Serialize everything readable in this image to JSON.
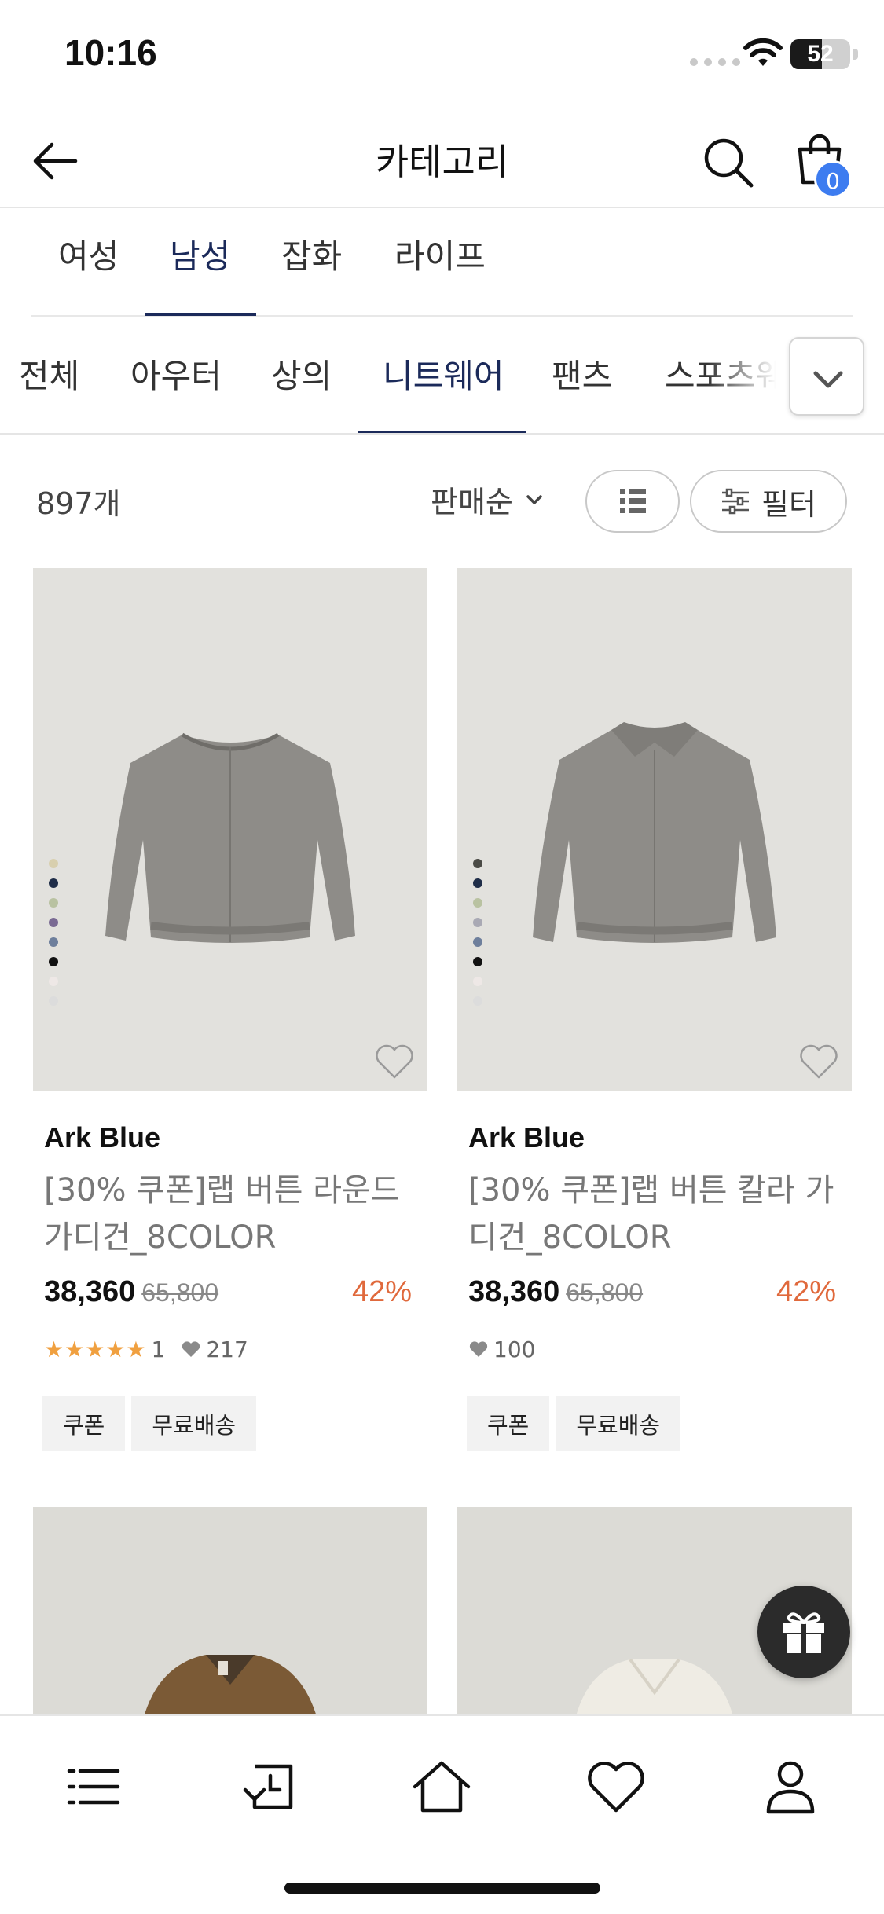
{
  "status_bar": {
    "time": "10:16",
    "battery": "52",
    "battery_level": 0.52
  },
  "header": {
    "title": "카테고리",
    "cart_count": "0"
  },
  "primary_tabs": [
    {
      "label": "여성",
      "active": false
    },
    {
      "label": "남성",
      "active": true
    },
    {
      "label": "잡화",
      "active": false
    },
    {
      "label": "라이프",
      "active": false
    }
  ],
  "secondary_tabs": [
    {
      "label": "전체",
      "active": false
    },
    {
      "label": "아우터",
      "active": false
    },
    {
      "label": "상의",
      "active": false
    },
    {
      "label": "니트웨어",
      "active": true
    },
    {
      "label": "팬츠",
      "active": false
    },
    {
      "label": "스포츠웨",
      "active": false
    }
  ],
  "toolbar": {
    "count": "897개",
    "sort": "판매순",
    "filter": "필터"
  },
  "products": [
    {
      "brand": "Ark Blue",
      "name": "[30% 쿠폰]랩 버튼 라운드 가디건_8COLOR",
      "price": "38,360",
      "original_price": "65,800",
      "discount": "42%",
      "stars": "★★★★★",
      "rating_count": "1",
      "likes": "217",
      "tags": [
        "쿠폰",
        "무료배송"
      ],
      "swatch_colors": [
        "#d8cfae",
        "#1f2d48",
        "#b9c2a1",
        "#7a6a93",
        "#6e7f9c",
        "#111111",
        "#eee8e6",
        "#dcdcdc"
      ]
    },
    {
      "brand": "Ark Blue",
      "name": "[30% 쿠폰]랩 버튼 칼라 가디건_8COLOR",
      "price": "38,360",
      "original_price": "65,800",
      "discount": "42%",
      "stars": "",
      "rating_count": "",
      "likes": "100",
      "tags": [
        "쿠폰",
        "무료배송"
      ],
      "swatch_colors": [
        "#4a4a45",
        "#1f2d48",
        "#b9c2a1",
        "#a9a9b4",
        "#6e7f9c",
        "#111111",
        "#eee8e6",
        "#dcdcdc"
      ]
    }
  ],
  "icons": {
    "back": "arrow-left-icon",
    "search": "search-icon",
    "cart": "shopping-bag-icon",
    "expand": "chevron-down-icon",
    "list_view": "list-view-icon",
    "filter": "sliders-icon",
    "wish": "heart-outline-icon",
    "gift": "gift-icon",
    "nav": [
      "menu-icon",
      "recent-icon",
      "home-icon",
      "heart-icon",
      "user-icon"
    ]
  },
  "colors": {
    "accent": "#1b2a5a",
    "badge": "#3d7cf0",
    "discount": "#e0693c",
    "star": "#f0a040"
  }
}
